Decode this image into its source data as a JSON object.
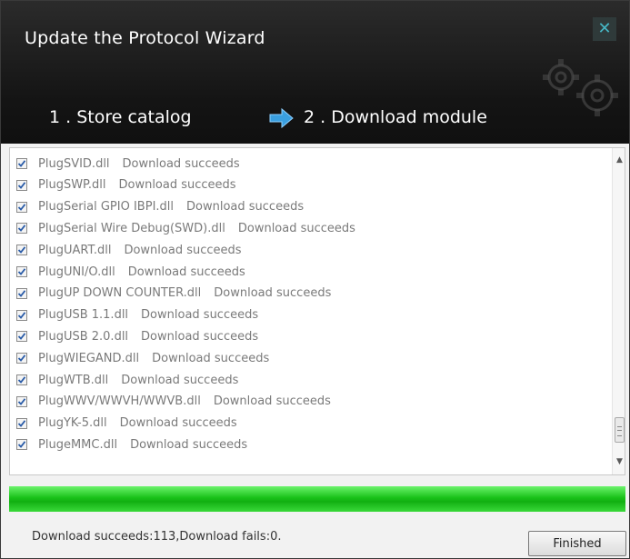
{
  "window": {
    "title": "Update the Protocol Wizard",
    "close_icon": "close-icon",
    "steps": [
      {
        "label": "1 . Store catalog"
      },
      {
        "label": "2 . Download module"
      }
    ],
    "arrow_icon": "arrow-right-icon",
    "decoration_icon": "gears-icon"
  },
  "list": {
    "items": [
      {
        "checked": true,
        "file": "PlugSVID.dll",
        "status": "Download succeeds"
      },
      {
        "checked": true,
        "file": "PlugSWP.dll",
        "status": "Download succeeds"
      },
      {
        "checked": true,
        "file": "PlugSerial GPIO IBPI.dll",
        "status": "Download succeeds"
      },
      {
        "checked": true,
        "file": "PlugSerial Wire Debug(SWD).dll",
        "status": "Download succeeds"
      },
      {
        "checked": true,
        "file": "PlugUART.dll",
        "status": "Download succeeds"
      },
      {
        "checked": true,
        "file": "PlugUNI/O.dll",
        "status": "Download succeeds"
      },
      {
        "checked": true,
        "file": "PlugUP DOWN COUNTER.dll",
        "status": "Download succeeds"
      },
      {
        "checked": true,
        "file": "PlugUSB 1.1.dll",
        "status": "Download succeeds"
      },
      {
        "checked": true,
        "file": "PlugUSB 2.0.dll",
        "status": "Download succeeds"
      },
      {
        "checked": true,
        "file": "PlugWIEGAND.dll",
        "status": "Download succeeds"
      },
      {
        "checked": true,
        "file": "PlugWTB.dll",
        "status": "Download succeeds"
      },
      {
        "checked": true,
        "file": "PlugWWV/WWVH/WWVB.dll",
        "status": "Download succeeds"
      },
      {
        "checked": true,
        "file": "PlugYK-5.dll",
        "status": "Download succeeds"
      },
      {
        "checked": true,
        "file": "PlugeMMC.dll",
        "status": "Download succeeds"
      }
    ]
  },
  "progress": {
    "fraction": 1.0,
    "color": "#19c219"
  },
  "footer": {
    "summary": "Download succeeds:113,Download fails:0.",
    "finished_label": "Finished"
  },
  "colors": {
    "header_bg": "#141414",
    "accent": "#46b6c4",
    "arrow": "#3a9fe0"
  }
}
